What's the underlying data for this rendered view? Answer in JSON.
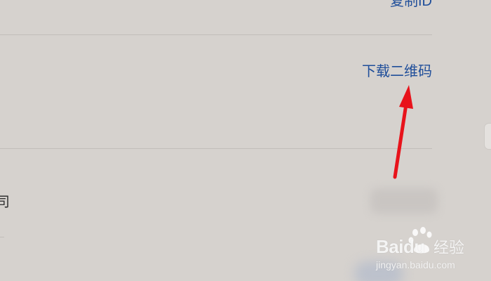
{
  "rows": {
    "copy_id_label": "复制ID",
    "download_qr_label": "下载二维码",
    "left_edge_fragment": "司"
  },
  "watermark": {
    "logo_text": "Baidu",
    "logo_suffix": "经验",
    "url": "jingyan.baidu.com"
  },
  "icons": {
    "annotation": "red-arrow-icon",
    "watermark": "paw-print-icon"
  },
  "colors": {
    "background": "#d6d2ce",
    "link": "#1f4e9a",
    "annotation": "#e8131b"
  }
}
